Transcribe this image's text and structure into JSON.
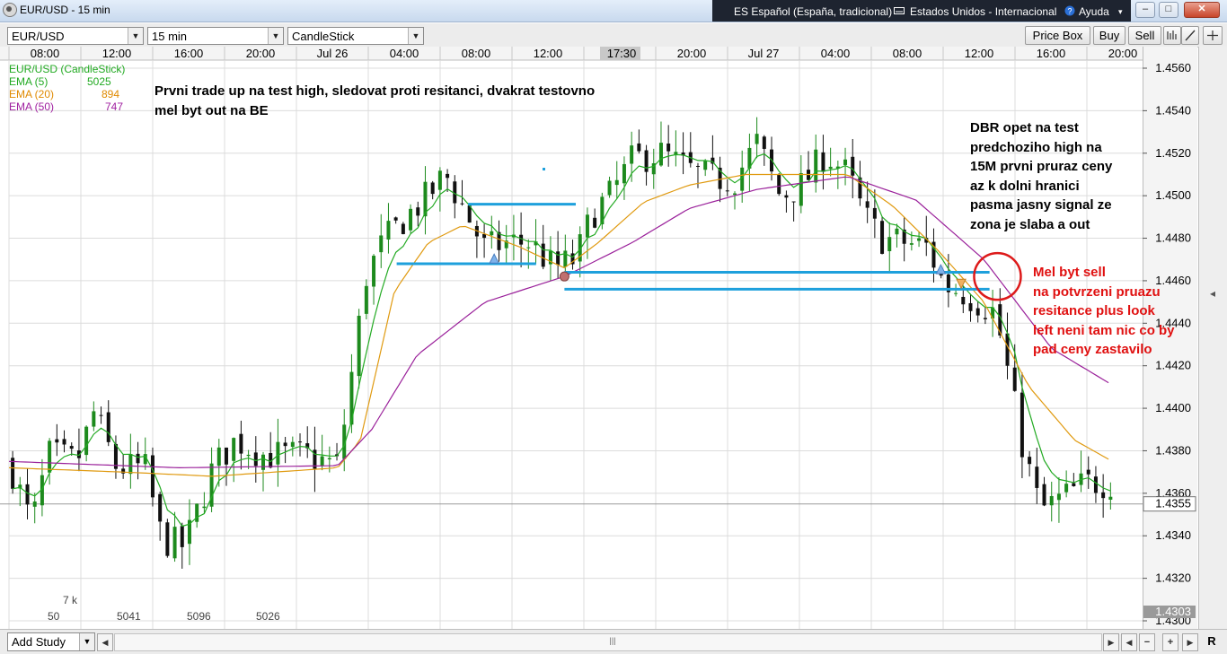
{
  "window": {
    "title": "EUR/USD - 15 min",
    "tray": {
      "keyboard_language": "ES Español (España, tradicional)",
      "keyboard_layout": "Estados Unidos - Internacional",
      "help": "Ayuda"
    },
    "controls": {
      "minimize": "–",
      "maximize": "□",
      "close": "✕"
    }
  },
  "toolbar": {
    "symbol": "EUR/USD",
    "interval": "15 min",
    "chart_type": "CandleStick",
    "price_box": "Price Box",
    "buy": "Buy",
    "sell": "Sell"
  },
  "legend": {
    "title": "EUR/USD (CandleStick)",
    "items": [
      {
        "name": "EMA (5)",
        "value": "5025",
        "color": "#22aa22"
      },
      {
        "name": "EMA (20)",
        "value": "894",
        "color": "#e08a00"
      },
      {
        "name": "EMA (50)",
        "value": "747",
        "color": "#a020a0"
      }
    ]
  },
  "annotations": {
    "note_left": "Prvni trade up na test high, sledovat proti resitanci, dvakrat testovno\nmel byt out na BE",
    "note_right": "DBR opet na test\npredchoziho high na\n15M prvni pruraz ceny\naz k dolni hranici\npasma jasny signal ze\nzona je slaba a out",
    "note_red": "Mel byt sell\nna potvrzeni pruazu\nresitance plus look\nleft neni tam nic co by\npad ceny zastavilo"
  },
  "volume_labels": [
    "7 k",
    "50",
    "5041",
    "5096",
    "5026"
  ],
  "chart_data": {
    "type": "candlestick",
    "symbol": "EUR/USD",
    "interval": "15 min",
    "ylim": [
      1.43,
      1.456
    ],
    "y_ticks": [
      "1.4560",
      "1.4540",
      "1.4520",
      "1.4500",
      "1.4480",
      "1.4460",
      "1.4440",
      "1.4420",
      "1.4400",
      "1.4380",
      "1.4360",
      "1.4340",
      "1.4320",
      "1.4300"
    ],
    "x_ticks": [
      "08:00",
      "12:00",
      "16:00",
      "20:00",
      "Jul 26",
      "04:00",
      "08:00",
      "12:00",
      "16:00",
      "20:00",
      "Jul 27",
      "04:00",
      "08:00",
      "12:00",
      "16:00",
      "20:00"
    ],
    "cursor_time": "17:30",
    "last_price": "1.4355",
    "bottom_price": "1.4303",
    "price_path": [
      {
        "x": 0,
        "y": 1.4375
      },
      {
        "x": 0.02,
        "y": 1.4345
      },
      {
        "x": 0.035,
        "y": 1.4378
      },
      {
        "x": 0.06,
        "y": 1.4375
      },
      {
        "x": 0.075,
        "y": 1.4398
      },
      {
        "x": 0.095,
        "y": 1.4372
      },
      {
        "x": 0.12,
        "y": 1.4372
      },
      {
        "x": 0.135,
        "y": 1.4338
      },
      {
        "x": 0.155,
        "y": 1.4335
      },
      {
        "x": 0.18,
        "y": 1.4372
      },
      {
        "x": 0.2,
        "y": 1.4385
      },
      {
        "x": 0.225,
        "y": 1.4378
      },
      {
        "x": 0.26,
        "y": 1.4378
      },
      {
        "x": 0.29,
        "y": 1.4373
      },
      {
        "x": 0.3,
        "y": 1.4408
      },
      {
        "x": 0.315,
        "y": 1.4462
      },
      {
        "x": 0.33,
        "y": 1.4478
      },
      {
        "x": 0.35,
        "y": 1.449
      },
      {
        "x": 0.37,
        "y": 1.45
      },
      {
        "x": 0.385,
        "y": 1.451
      },
      {
        "x": 0.4,
        "y": 1.4495
      },
      {
        "x": 0.42,
        "y": 1.4475
      },
      {
        "x": 0.44,
        "y": 1.4478
      },
      {
        "x": 0.46,
        "y": 1.4478
      },
      {
        "x": 0.48,
        "y": 1.4466
      },
      {
        "x": 0.5,
        "y": 1.447
      },
      {
        "x": 0.515,
        "y": 1.4492
      },
      {
        "x": 0.53,
        "y": 1.45
      },
      {
        "x": 0.55,
        "y": 1.4517
      },
      {
        "x": 0.575,
        "y": 1.452
      },
      {
        "x": 0.6,
        "y": 1.4512
      },
      {
        "x": 0.62,
        "y": 1.4508
      },
      {
        "x": 0.64,
        "y": 1.4508
      },
      {
        "x": 0.66,
        "y": 1.4525
      },
      {
        "x": 0.68,
        "y": 1.45
      },
      {
        "x": 0.7,
        "y": 1.4505
      },
      {
        "x": 0.72,
        "y": 1.452
      },
      {
        "x": 0.74,
        "y": 1.451
      },
      {
        "x": 0.755,
        "y": 1.449
      },
      {
        "x": 0.77,
        "y": 1.448
      },
      {
        "x": 0.79,
        "y": 1.4478
      },
      {
        "x": 0.81,
        "y": 1.4476
      },
      {
        "x": 0.825,
        "y": 1.4458
      },
      {
        "x": 0.84,
        "y": 1.4455
      },
      {
        "x": 0.855,
        "y": 1.445
      },
      {
        "x": 0.87,
        "y": 1.4445
      },
      {
        "x": 0.88,
        "y": 1.442
      },
      {
        "x": 0.895,
        "y": 1.438
      },
      {
        "x": 0.91,
        "y": 1.4352
      },
      {
        "x": 0.93,
        "y": 1.4358
      },
      {
        "x": 0.95,
        "y": 1.4365
      },
      {
        "x": 0.97,
        "y": 1.4365
      }
    ],
    "ema_20_path": [
      {
        "x": 0,
        "y": 1.4372
      },
      {
        "x": 0.1,
        "y": 1.437
      },
      {
        "x": 0.18,
        "y": 1.4368
      },
      {
        "x": 0.29,
        "y": 1.4372
      },
      {
        "x": 0.31,
        "y": 1.4385
      },
      {
        "x": 0.34,
        "y": 1.4455
      },
      {
        "x": 0.37,
        "y": 1.4478
      },
      {
        "x": 0.4,
        "y": 1.4486
      },
      {
        "x": 0.45,
        "y": 1.4476
      },
      {
        "x": 0.49,
        "y": 1.4466
      },
      {
        "x": 0.52,
        "y": 1.4478
      },
      {
        "x": 0.56,
        "y": 1.4497
      },
      {
        "x": 0.6,
        "y": 1.4505
      },
      {
        "x": 0.65,
        "y": 1.451
      },
      {
        "x": 0.7,
        "y": 1.451
      },
      {
        "x": 0.74,
        "y": 1.451
      },
      {
        "x": 0.78,
        "y": 1.4495
      },
      {
        "x": 0.82,
        "y": 1.4474
      },
      {
        "x": 0.86,
        "y": 1.445
      },
      {
        "x": 0.9,
        "y": 1.441
      },
      {
        "x": 0.94,
        "y": 1.4385
      },
      {
        "x": 0.97,
        "y": 1.4376
      }
    ],
    "ema_50_path": [
      {
        "x": 0,
        "y": 1.4375
      },
      {
        "x": 0.15,
        "y": 1.4372
      },
      {
        "x": 0.29,
        "y": 1.4373
      },
      {
        "x": 0.32,
        "y": 1.439
      },
      {
        "x": 0.36,
        "y": 1.4425
      },
      {
        "x": 0.42,
        "y": 1.445
      },
      {
        "x": 0.49,
        "y": 1.4462
      },
      {
        "x": 0.55,
        "y": 1.4478
      },
      {
        "x": 0.6,
        "y": 1.4494
      },
      {
        "x": 0.66,
        "y": 1.4503
      },
      {
        "x": 0.74,
        "y": 1.4509
      },
      {
        "x": 0.8,
        "y": 1.4498
      },
      {
        "x": 0.86,
        "y": 1.447
      },
      {
        "x": 0.92,
        "y": 1.4428
      },
      {
        "x": 0.97,
        "y": 1.4412
      }
    ],
    "levels": [
      {
        "from": 0.405,
        "to": 0.5,
        "y": 1.4496
      },
      {
        "from": 0.342,
        "to": 0.465,
        "y": 1.4468
      },
      {
        "from": 0.49,
        "to": 0.865,
        "y": 1.4464
      },
      {
        "from": 0.49,
        "to": 0.865,
        "y": 1.4456
      }
    ],
    "markers": [
      {
        "type": "buy",
        "x": 0.428,
        "y": 1.447
      },
      {
        "type": "exit",
        "x": 0.49,
        "y": 1.4462
      },
      {
        "type": "buy",
        "x": 0.822,
        "y": 1.4465
      },
      {
        "type": "sell",
        "x": 0.84,
        "y": 1.4459
      }
    ],
    "highlight_circle": {
      "x": 0.872,
      "y": 1.4462
    },
    "colors": {
      "up": "#1d8a1d",
      "down": "#111111",
      "ema5": "#22aa22",
      "ema20": "#e09a10",
      "ema50": "#9a209a",
      "level": "#1ea0dc",
      "circle": "#dd1a1a"
    }
  },
  "bottombar": {
    "add_study": "Add Study",
    "reset": "R"
  }
}
